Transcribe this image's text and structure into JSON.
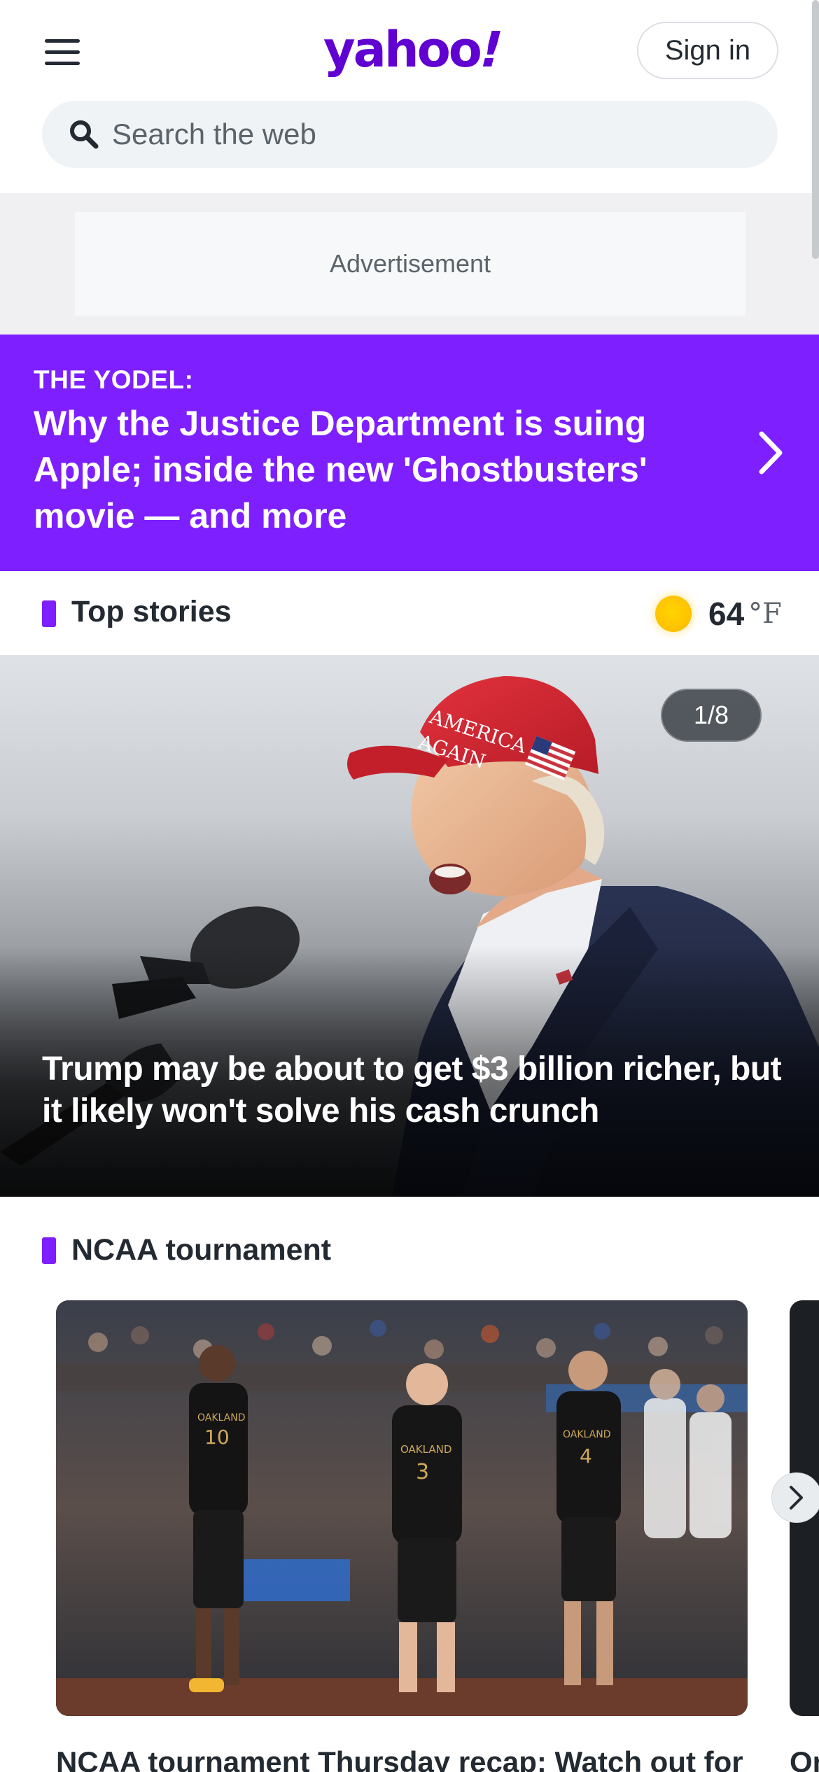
{
  "header": {
    "logo_text": "yahoo",
    "logo_bang": "!",
    "signin_label": "Sign in"
  },
  "search": {
    "placeholder": "Search the web",
    "value": ""
  },
  "ad": {
    "label": "Advertisement"
  },
  "yodel": {
    "kicker": "THE YODEL:",
    "title": "Why the Justice Department is suing Apple; inside the new 'Ghostbusters' movie — and more"
  },
  "top_stories": {
    "section_title": "Top stories",
    "weather": {
      "temperature": "64",
      "unit": "°F",
      "icon": "sun-icon"
    },
    "hero": {
      "counter": "1/8",
      "title": "Trump may be about to get $3 billion richer, but it likely won't solve his cash crunch",
      "cap_text_line1": "AMERICA",
      "cap_text_line2": "AGAIN"
    }
  },
  "ncaa": {
    "section_title": "NCAA tournament",
    "cards": [
      {
        "title": "NCAA tournament Thursday recap: Watch out for",
        "jersey_numbers": [
          "10",
          "3",
          "4"
        ],
        "jersey_text": "OAKLAND"
      },
      {
        "title": "Or"
      }
    ]
  },
  "colors": {
    "brand": "#6001d2",
    "accent": "#7e1fff",
    "text": "#232a31"
  }
}
